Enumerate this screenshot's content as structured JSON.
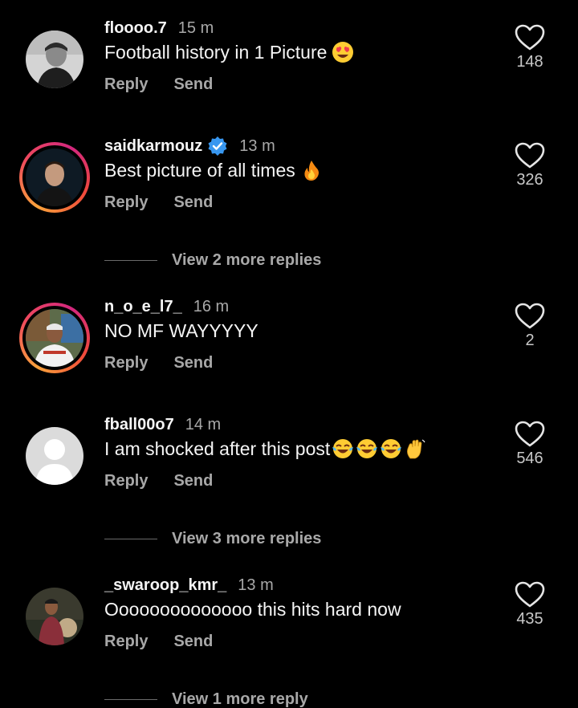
{
  "comments": [
    {
      "username": "floooo.7",
      "time": "15 m",
      "text": "Football history in 1 Picture",
      "emojis": [
        "heart-eyes-emoji"
      ],
      "likes": "148",
      "verified": false,
      "story_ring": false,
      "reply_label": "Reply",
      "send_label": "Send"
    },
    {
      "username": "saidkarmouz",
      "time": "13 m",
      "text": "Best picture of all times",
      "emojis": [
        "fire-emoji"
      ],
      "likes": "326",
      "verified": true,
      "story_ring": true,
      "reply_label": "Reply",
      "send_label": "Send",
      "more_replies": "View 2 more replies"
    },
    {
      "username": "n_o_e_l7_",
      "time": "16 m",
      "text": "NO MF WAYYYYY",
      "emojis": [],
      "likes": "2",
      "verified": false,
      "story_ring": true,
      "reply_label": "Reply",
      "send_label": "Send"
    },
    {
      "username": "fball00o7",
      "time": "14 m",
      "text": "I am shocked after this post",
      "emojis": [
        "tears-of-joy-emoji",
        "tears-of-joy-emoji",
        "tears-of-joy-emoji",
        "waving-hand-emoji"
      ],
      "likes": "546",
      "verified": false,
      "story_ring": false,
      "reply_label": "Reply",
      "send_label": "Send",
      "more_replies": "View 3 more replies"
    },
    {
      "username": "_swaroop_kmr_",
      "time": "13 m",
      "text": "Oooooooooooooo this hits hard now",
      "emojis": [],
      "likes": "435",
      "verified": false,
      "story_ring": false,
      "reply_label": "Reply",
      "send_label": "Send",
      "more_replies": "View 1 more reply"
    }
  ],
  "colors": {
    "background": "#000000",
    "text": "#f5f5f5",
    "secondary": "#a8a8a8",
    "verified": "#3897f0"
  }
}
